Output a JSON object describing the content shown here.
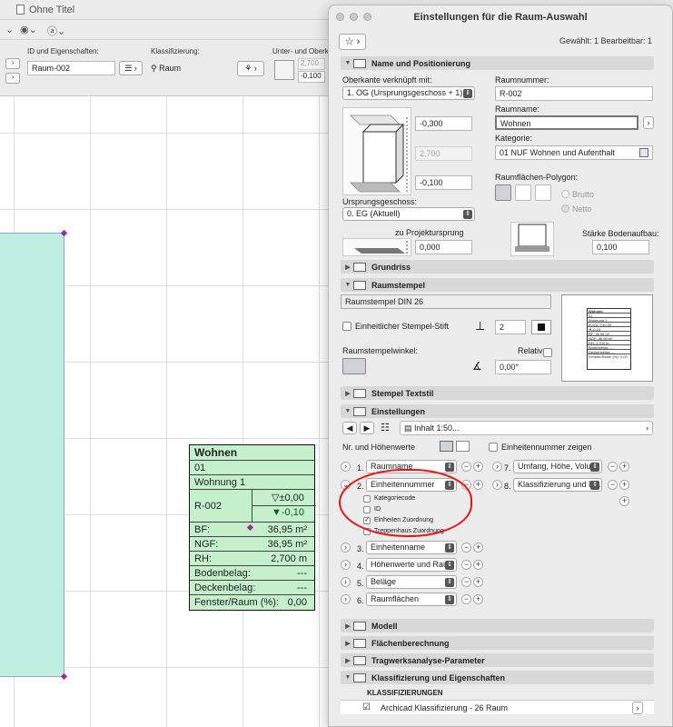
{
  "background": {
    "window_title": "Ohne Titel",
    "info_labels": {
      "id": "ID und Eigenschaften:",
      "class": "Klassifizierung:",
      "top": "Unter- und Oberkante"
    },
    "id_value": "Raum-002",
    "class_value": "Raum",
    "top_values": [
      "2,700",
      "-0,100"
    ]
  },
  "stamp": {
    "name": "Wohnen",
    "number_row": "01",
    "name_row": "Wohnung 1",
    "id": "R-002",
    "level_top": "▽±0,00",
    "level_bottom": "▼-0,10",
    "bf_label": "BF:",
    "bf_value": "36,95 m²",
    "ngf_label": "NGF:",
    "ngf_value": "36,95 m²",
    "rh_label": "RH:",
    "rh_value": "2,700 m",
    "boden_label": "Bodenbelag:",
    "boden_value": "---",
    "decken_label": "Deckenbelag:",
    "decken_value": "---",
    "fenster_label": "Fenster/Raum (%):",
    "fenster_value": "0,00"
  },
  "dialog": {
    "title": "Einstellungen für die Raum-Auswahl",
    "fav_label": "☆ ›",
    "selection_info": "Gewählt: 1 Bearbeitbar: 1",
    "sections": {
      "name_pos": "Name und Positionierung",
      "grundriss": "Grundriss",
      "raumstempel": "Raumstempel",
      "stempel_textstil": "Stempel Textstil",
      "einstellungen": "Einstellungen",
      "modell": "Modell",
      "flaechen": "Flächenberechnung",
      "tragwerk": "Tragwerksanalyse-Parameter",
      "klassifizierung": "Klassifizierung und Eigenschaften"
    },
    "name_pos": {
      "oberkante_label": "Oberkante verknüpft mit:",
      "oberkante_value": "1. OG (Ursprungsgeschoss + 1)",
      "top_offset": "-0,300",
      "height": "2,700",
      "bottom_offset": "-0,100",
      "ursprung_label": "Ursprungsgeschoss:",
      "ursprung_value": "0. EG (Aktuell)",
      "projekt_label": "zu Projektursprung",
      "projekt_value": "0,000",
      "raumnummer_label": "Raumnummer:",
      "raumnummer_value": "R-002",
      "raumname_label": "Raumname:",
      "raumname_value": "Wohnen",
      "kategorie_label": "Kategorie:",
      "kategorie_value": "01 NUF Wohnen und Aufenthalt",
      "polygon_label": "Raumflächen-Polygon:",
      "brutto": "Brutto",
      "netto": "Netto",
      "boden_label": "Stärke Bodenaufbau:",
      "boden_value": "0,100"
    },
    "raumstempel": {
      "stempel_name": "Raumstempel DIN 26",
      "einheitlich_label": "Einheitlicher Stempel-Stift",
      "stift_value": "2",
      "winkel_label": "Raumstempelwinkel:",
      "relativ_label": "Relativ",
      "winkel_value": "0,00°"
    },
    "einstellungen": {
      "inhalt_value": "Inhalt 1:50...",
      "nr_label": "Nr. und Höhenwerte",
      "einheitennummer_zeigen": "Einheitennummer zeigen",
      "rows": [
        {
          "num": "1.",
          "value": "Raumname"
        },
        {
          "num": "2.",
          "value": "Einheitennummer"
        },
        {
          "num": "3.",
          "value": "Einheitenname"
        },
        {
          "num": "4.",
          "value": "Höhenwerte und Rau..."
        },
        {
          "num": "5.",
          "value": "Beläge"
        },
        {
          "num": "6.",
          "value": "Raumflächen"
        }
      ],
      "rows_right": [
        {
          "num": "7.",
          "value": "Umfang, Höhe, Volu..."
        },
        {
          "num": "8.",
          "value": "Klassifizierung und E..."
        }
      ],
      "sub_options": [
        "Kategoriecode",
        "ID",
        "Einheiten Zuordnung",
        "Treppenhaus Zuordnung"
      ]
    },
    "klassifizierung": {
      "header": "KLASSIFIZIERUNGEN",
      "item": "Archicad Klassifizierung - 26 Raum"
    }
  },
  "preview": {
    "lines": [
      "Wohnen",
      "01",
      "Wohnung 1",
      "R-002   ▽±0,00",
      "        ▼-0,10",
      "BF:      36,95 m²",
      "NGF:     36,95 m²",
      "RH:       2,700 m",
      "Bodenbelag:     ---",
      "Deckenbelag:    ---",
      "Fenster/Raum (%): 0,00"
    ]
  },
  "colors": {
    "annotation_red": "#ee1111",
    "room_fill": "#bfeee0",
    "stamp_fill": "#c4f0cc"
  }
}
